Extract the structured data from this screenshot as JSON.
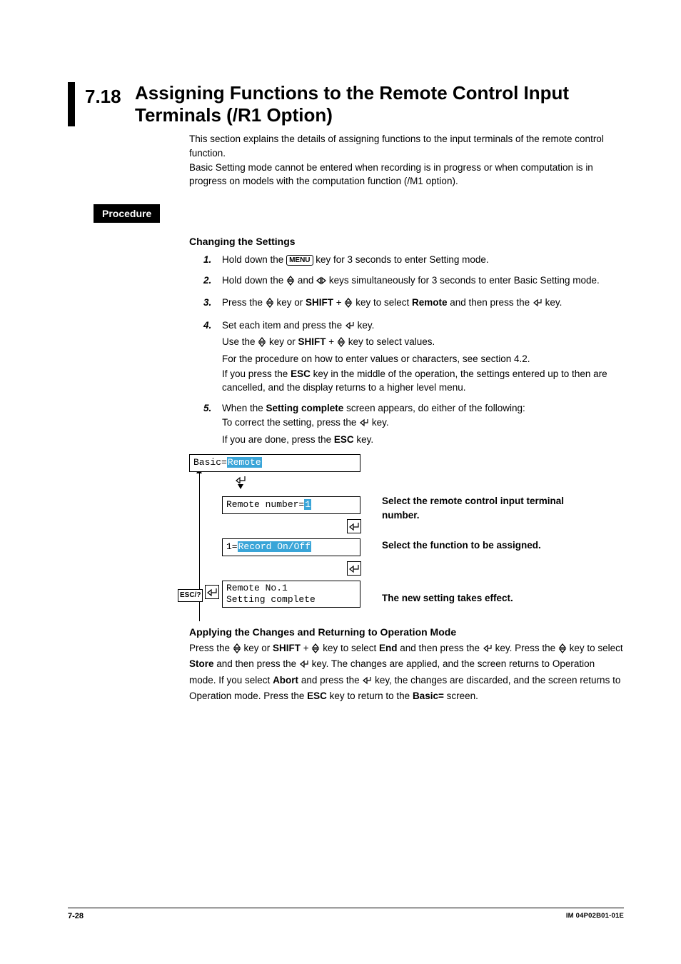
{
  "header": {
    "number": "7.18",
    "title": "Assigning Functions to the Remote Control Input Terminals (/R1 Option)"
  },
  "intro": {
    "p1": "This section explains the details of assigning functions to the input terminals of the remote control function.",
    "p2": "Basic Setting mode cannot be entered when recording is in progress or when computation is in progress on models with the computation function (/M1 option)."
  },
  "procedure_label": "Procedure",
  "changing_heading": "Changing the Settings",
  "menu_key": "MENU",
  "steps": {
    "s1": {
      "num": "1.",
      "pre": "Hold down the ",
      "post": " key for 3 seconds to enter Setting mode."
    },
    "s2": {
      "num": "2.",
      "pre": "Hold down the ",
      "mid": " and ",
      "post": " keys simultaneously for 3 seconds to enter Basic Setting mode."
    },
    "s3": {
      "num": "3.",
      "pre": "Press the ",
      "mid1": " key or ",
      "shift": "SHIFT",
      "mid2": " + ",
      "mid3": " key to select ",
      "remote": "Remote",
      "post": " and then press the ",
      "tail": " key."
    },
    "s4": {
      "num": "4.",
      "l1_pre": "Set each item and press the ",
      "l1_post": " key.",
      "l2_pre": "Use the ",
      "l2_mid1": " key or ",
      "l2_shift": "SHIFT",
      "l2_mid2": " + ",
      "l2_post": " key to select values.",
      "l3": "For the procedure on how to enter values or characters, see section 4.2.",
      "l4_pre": "If you press the ",
      "l4_esc": "ESC",
      "l4_post": " key in the middle of the operation, the settings entered up to then are cancelled, and the display returns to a higher level menu."
    },
    "s5": {
      "num": "5.",
      "l1_pre": "When the ",
      "l1_b": "Setting complete",
      "l1_post": " screen appears, do either of the following:",
      "l2_pre": "To correct the setting, press the ",
      "l2_post": " key.",
      "l3_pre": "If you are done, press the ",
      "l3_esc": "ESC",
      "l3_post": " key."
    }
  },
  "diagram": {
    "top_prefix": "Basic=",
    "top_hl": "Remote",
    "mid_prefix": "Remote number=",
    "mid_hl": "1",
    "fn_prefix": "1=",
    "fn_hl": "Record On/Off",
    "bot_l1": "Remote No.1",
    "bot_l2": "Setting complete",
    "esc": "ESC/?",
    "anno1": "Select the remote control input terminal number.",
    "anno2": "Select the function to be assigned.",
    "anno3": "The new setting takes effect."
  },
  "apply": {
    "heading": "Applying the Changes and Returning to Operation Mode",
    "t1": "Press the ",
    "t2": " key or ",
    "shift": "SHIFT",
    "t3": " + ",
    "t4": " key to select ",
    "end": "End",
    "t5": " and then press the ",
    "t6": " key. Press the ",
    "t7": " key to select ",
    "store": "Store",
    "t8": " and then press the ",
    "t9": " key. The changes are applied, and the screen returns to Operation mode. If you select ",
    "abort": "Abort",
    "t10": " and press the ",
    "t11": " key, the changes are discarded, and the screen returns to Operation mode. Press the ",
    "esc": "ESC",
    "t12": " key to return to the ",
    "basic": "Basic=",
    "t13": " screen."
  },
  "footer": {
    "left": "7-28",
    "right": "IM 04P02B01-01E"
  }
}
